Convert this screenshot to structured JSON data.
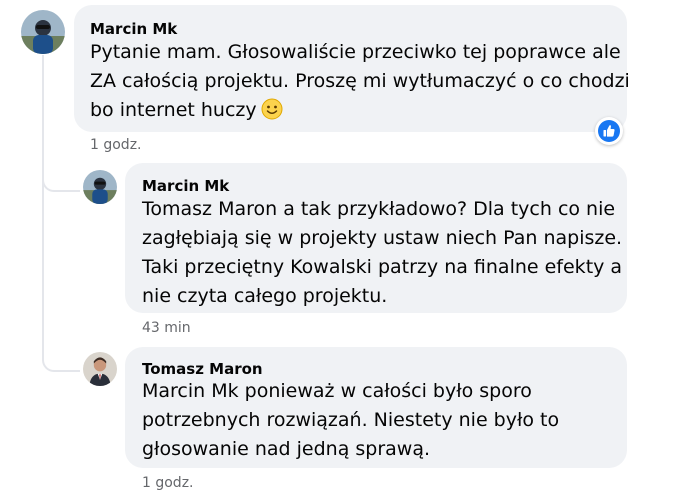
{
  "comments": [
    {
      "author": "Marcin Mk",
      "lines": [
        "Pytanie mam. Głosowaliście przeciwko tej poprawce ale",
        "ZA całością projektu. Proszę mi wytłumaczyć o co chodzi",
        "bo internet huczy"
      ],
      "emoji": "slightly-smiling-face",
      "reaction": "like",
      "time": "1 godz."
    },
    {
      "author": "Marcin Mk",
      "lines": [
        "Tomasz Maron a tak przykładowo? Dla tych co nie",
        "zagłębiają się w projekty ustaw niech Pan napisze.",
        "Taki przeciętny Kowalski patrzy na finalne efekty a",
        "nie czyta całego projektu."
      ],
      "time": "43 min"
    },
    {
      "author": "Tomasz Maron",
      "lines": [
        "Marcin Mk ponieważ w całości było sporo",
        "potrzebnych rozwiązań. Niestety nie było to",
        "głosowanie nad jedną sprawą."
      ],
      "time": "1 godz."
    }
  ],
  "colors": {
    "bubble": "#f0f2f5",
    "meta_text": "#65676b",
    "like_blue": "#1877f2"
  }
}
